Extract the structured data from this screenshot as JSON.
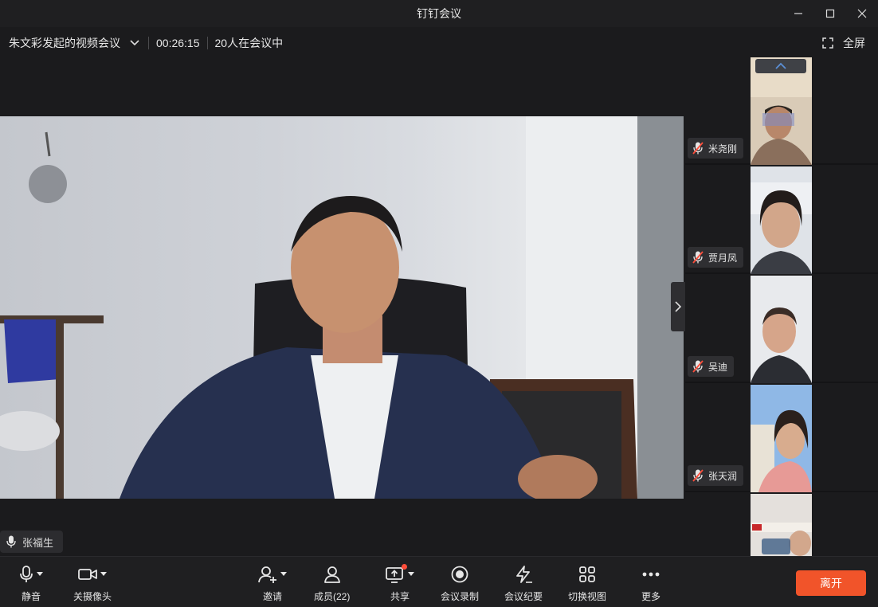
{
  "window": {
    "title": "钉钉会议"
  },
  "info": {
    "meeting_name": "朱文彩发起的视频会议",
    "duration": "00:26:15",
    "participants_in_meeting": "20人在会议中",
    "fullscreen_label": "全屏"
  },
  "stage": {
    "speaker_name": "张福生"
  },
  "sidebar": {
    "participants": [
      {
        "name": "米尧刚"
      },
      {
        "name": "贾月凤"
      },
      {
        "name": "吴迪"
      },
      {
        "name": "张天润"
      },
      {
        "name": ""
      }
    ]
  },
  "toolbar": {
    "mute": "静音",
    "camera_off": "关摄像头",
    "invite": "邀请",
    "members": "成员(22)",
    "share": "共享",
    "record": "会议录制",
    "minutes": "会议纪要",
    "switch_view": "切换视图",
    "more": "更多",
    "leave": "离开"
  },
  "colors": {
    "accent_leave": "#f1542a",
    "badge": "#ff4d3a",
    "bg": "#1b1b1d"
  }
}
